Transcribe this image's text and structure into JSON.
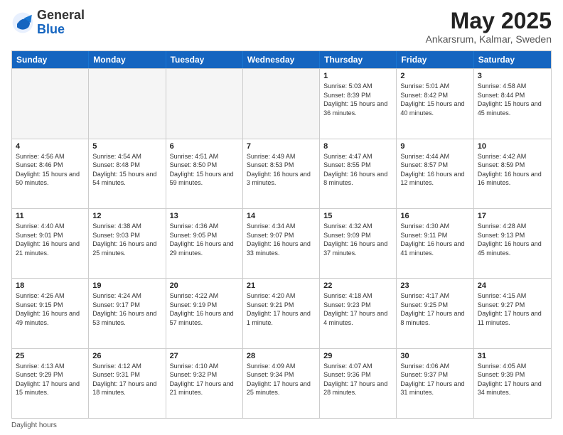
{
  "header": {
    "logo": {
      "general": "General",
      "blue": "Blue"
    },
    "title": "May 2025",
    "location": "Ankarsrum, Kalmar, Sweden"
  },
  "dayHeaders": [
    "Sunday",
    "Monday",
    "Tuesday",
    "Wednesday",
    "Thursday",
    "Friday",
    "Saturday"
  ],
  "weeks": [
    [
      {
        "date": "",
        "sunrise": "",
        "sunset": "",
        "daylight": "",
        "empty": true
      },
      {
        "date": "",
        "sunrise": "",
        "sunset": "",
        "daylight": "",
        "empty": true
      },
      {
        "date": "",
        "sunrise": "",
        "sunset": "",
        "daylight": "",
        "empty": true
      },
      {
        "date": "",
        "sunrise": "",
        "sunset": "",
        "daylight": "",
        "empty": true
      },
      {
        "date": "1",
        "sunrise": "Sunrise: 5:03 AM",
        "sunset": "Sunset: 8:39 PM",
        "daylight": "Daylight: 15 hours and 36 minutes.",
        "empty": false
      },
      {
        "date": "2",
        "sunrise": "Sunrise: 5:01 AM",
        "sunset": "Sunset: 8:42 PM",
        "daylight": "Daylight: 15 hours and 40 minutes.",
        "empty": false
      },
      {
        "date": "3",
        "sunrise": "Sunrise: 4:58 AM",
        "sunset": "Sunset: 8:44 PM",
        "daylight": "Daylight: 15 hours and 45 minutes.",
        "empty": false
      }
    ],
    [
      {
        "date": "4",
        "sunrise": "Sunrise: 4:56 AM",
        "sunset": "Sunset: 8:46 PM",
        "daylight": "Daylight: 15 hours and 50 minutes.",
        "empty": false
      },
      {
        "date": "5",
        "sunrise": "Sunrise: 4:54 AM",
        "sunset": "Sunset: 8:48 PM",
        "daylight": "Daylight: 15 hours and 54 minutes.",
        "empty": false
      },
      {
        "date": "6",
        "sunrise": "Sunrise: 4:51 AM",
        "sunset": "Sunset: 8:50 PM",
        "daylight": "Daylight: 15 hours and 59 minutes.",
        "empty": false
      },
      {
        "date": "7",
        "sunrise": "Sunrise: 4:49 AM",
        "sunset": "Sunset: 8:53 PM",
        "daylight": "Daylight: 16 hours and 3 minutes.",
        "empty": false
      },
      {
        "date": "8",
        "sunrise": "Sunrise: 4:47 AM",
        "sunset": "Sunset: 8:55 PM",
        "daylight": "Daylight: 16 hours and 8 minutes.",
        "empty": false
      },
      {
        "date": "9",
        "sunrise": "Sunrise: 4:44 AM",
        "sunset": "Sunset: 8:57 PM",
        "daylight": "Daylight: 16 hours and 12 minutes.",
        "empty": false
      },
      {
        "date": "10",
        "sunrise": "Sunrise: 4:42 AM",
        "sunset": "Sunset: 8:59 PM",
        "daylight": "Daylight: 16 hours and 16 minutes.",
        "empty": false
      }
    ],
    [
      {
        "date": "11",
        "sunrise": "Sunrise: 4:40 AM",
        "sunset": "Sunset: 9:01 PM",
        "daylight": "Daylight: 16 hours and 21 minutes.",
        "empty": false
      },
      {
        "date": "12",
        "sunrise": "Sunrise: 4:38 AM",
        "sunset": "Sunset: 9:03 PM",
        "daylight": "Daylight: 16 hours and 25 minutes.",
        "empty": false
      },
      {
        "date": "13",
        "sunrise": "Sunrise: 4:36 AM",
        "sunset": "Sunset: 9:05 PM",
        "daylight": "Daylight: 16 hours and 29 minutes.",
        "empty": false
      },
      {
        "date": "14",
        "sunrise": "Sunrise: 4:34 AM",
        "sunset": "Sunset: 9:07 PM",
        "daylight": "Daylight: 16 hours and 33 minutes.",
        "empty": false
      },
      {
        "date": "15",
        "sunrise": "Sunrise: 4:32 AM",
        "sunset": "Sunset: 9:09 PM",
        "daylight": "Daylight: 16 hours and 37 minutes.",
        "empty": false
      },
      {
        "date": "16",
        "sunrise": "Sunrise: 4:30 AM",
        "sunset": "Sunset: 9:11 PM",
        "daylight": "Daylight: 16 hours and 41 minutes.",
        "empty": false
      },
      {
        "date": "17",
        "sunrise": "Sunrise: 4:28 AM",
        "sunset": "Sunset: 9:13 PM",
        "daylight": "Daylight: 16 hours and 45 minutes.",
        "empty": false
      }
    ],
    [
      {
        "date": "18",
        "sunrise": "Sunrise: 4:26 AM",
        "sunset": "Sunset: 9:15 PM",
        "daylight": "Daylight: 16 hours and 49 minutes.",
        "empty": false
      },
      {
        "date": "19",
        "sunrise": "Sunrise: 4:24 AM",
        "sunset": "Sunset: 9:17 PM",
        "daylight": "Daylight: 16 hours and 53 minutes.",
        "empty": false
      },
      {
        "date": "20",
        "sunrise": "Sunrise: 4:22 AM",
        "sunset": "Sunset: 9:19 PM",
        "daylight": "Daylight: 16 hours and 57 minutes.",
        "empty": false
      },
      {
        "date": "21",
        "sunrise": "Sunrise: 4:20 AM",
        "sunset": "Sunset: 9:21 PM",
        "daylight": "Daylight: 17 hours and 1 minute.",
        "empty": false
      },
      {
        "date": "22",
        "sunrise": "Sunrise: 4:18 AM",
        "sunset": "Sunset: 9:23 PM",
        "daylight": "Daylight: 17 hours and 4 minutes.",
        "empty": false
      },
      {
        "date": "23",
        "sunrise": "Sunrise: 4:17 AM",
        "sunset": "Sunset: 9:25 PM",
        "daylight": "Daylight: 17 hours and 8 minutes.",
        "empty": false
      },
      {
        "date": "24",
        "sunrise": "Sunrise: 4:15 AM",
        "sunset": "Sunset: 9:27 PM",
        "daylight": "Daylight: 17 hours and 11 minutes.",
        "empty": false
      }
    ],
    [
      {
        "date": "25",
        "sunrise": "Sunrise: 4:13 AM",
        "sunset": "Sunset: 9:29 PM",
        "daylight": "Daylight: 17 hours and 15 minutes.",
        "empty": false
      },
      {
        "date": "26",
        "sunrise": "Sunrise: 4:12 AM",
        "sunset": "Sunset: 9:31 PM",
        "daylight": "Daylight: 17 hours and 18 minutes.",
        "empty": false
      },
      {
        "date": "27",
        "sunrise": "Sunrise: 4:10 AM",
        "sunset": "Sunset: 9:32 PM",
        "daylight": "Daylight: 17 hours and 21 minutes.",
        "empty": false
      },
      {
        "date": "28",
        "sunrise": "Sunrise: 4:09 AM",
        "sunset": "Sunset: 9:34 PM",
        "daylight": "Daylight: 17 hours and 25 minutes.",
        "empty": false
      },
      {
        "date": "29",
        "sunrise": "Sunrise: 4:07 AM",
        "sunset": "Sunset: 9:36 PM",
        "daylight": "Daylight: 17 hours and 28 minutes.",
        "empty": false
      },
      {
        "date": "30",
        "sunrise": "Sunrise: 4:06 AM",
        "sunset": "Sunset: 9:37 PM",
        "daylight": "Daylight: 17 hours and 31 minutes.",
        "empty": false
      },
      {
        "date": "31",
        "sunrise": "Sunrise: 4:05 AM",
        "sunset": "Sunset: 9:39 PM",
        "daylight": "Daylight: 17 hours and 34 minutes.",
        "empty": false
      }
    ]
  ],
  "footer": {
    "note": "Daylight hours"
  }
}
